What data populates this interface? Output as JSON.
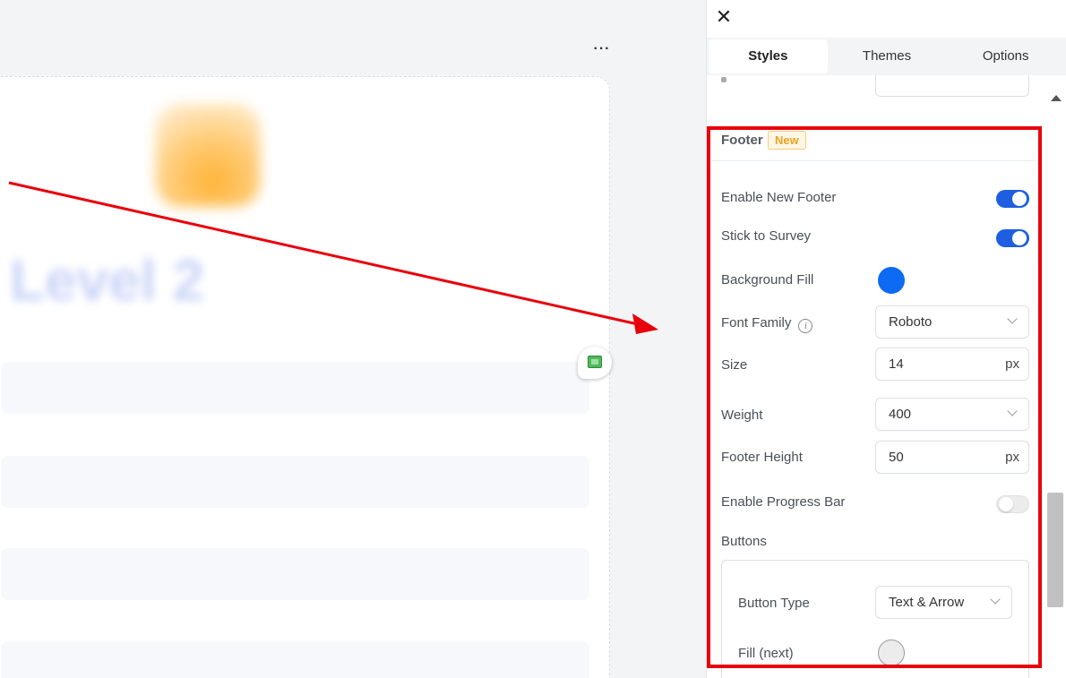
{
  "canvas": {
    "more_label": "···",
    "blurred_title": "Level 2"
  },
  "panel": {
    "close_label": "✕",
    "tabs": [
      {
        "label": "Styles",
        "active": true
      },
      {
        "label": "Themes",
        "active": false
      },
      {
        "label": "Options",
        "active": false
      }
    ],
    "footer": {
      "title": "Footer",
      "badge": "New",
      "enable_new_footer": {
        "label": "Enable New Footer",
        "on": true
      },
      "stick_to_survey": {
        "label": "Stick to Survey",
        "on": true
      },
      "background_fill": {
        "label": "Background Fill",
        "color": "#0d6af2"
      },
      "font_family": {
        "label": "Font Family",
        "value": "Roboto",
        "info_icon": "info-icon"
      },
      "size": {
        "label": "Size",
        "value": "14",
        "unit": "px"
      },
      "weight": {
        "label": "Weight",
        "value": "400"
      },
      "footer_height": {
        "label": "Footer Height",
        "value": "50",
        "unit": "px"
      },
      "enable_progress_bar": {
        "label": "Enable Progress Bar",
        "on": false
      },
      "buttons": {
        "label": "Buttons",
        "button_type": {
          "label": "Button Type",
          "value": "Text & Arrow"
        },
        "fill_next": {
          "label": "Fill (next)",
          "color": "#ececec"
        }
      }
    }
  },
  "colors": {
    "accent": "#1d5fe0",
    "highlight": "#e8000b",
    "badge": "#f0a020"
  }
}
